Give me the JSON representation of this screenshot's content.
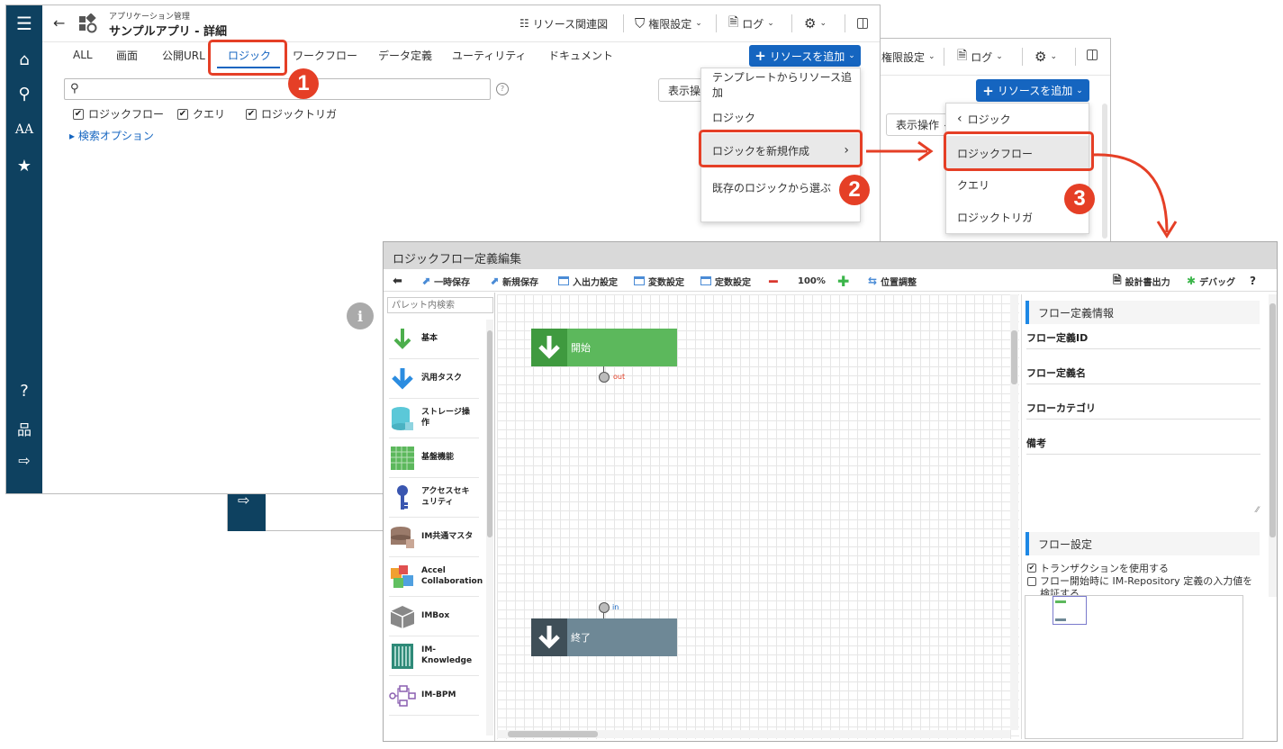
{
  "main_window": {
    "breadcrumb": "アプリケーション管理",
    "title": "サンプルアプリ - 詳細",
    "header_buttons": {
      "resource_map": "リソース関連図",
      "permissions": "権限設定",
      "log": "ログ"
    },
    "tabs": [
      "ALL",
      "画面",
      "公開URL",
      "ロジック",
      "ワークフロー",
      "データ定義",
      "ユーティリティ",
      "ドキュメント"
    ],
    "active_tab": "ロジック",
    "add_resource_label": "リソースを追加",
    "filters": [
      "ロジックフロー",
      "クエリ",
      "ロジックトリガ"
    ],
    "search_options": "▸ 検索オプション",
    "display_ops": "表示操作"
  },
  "dropdown1": {
    "items": [
      "テンプレートからリソース追加",
      "ロジック",
      "ロジックを新規作成",
      "既存のロジックから選ぶ"
    ]
  },
  "back_window": {
    "header_buttons": {
      "permissions": "権限設定",
      "log": "ログ"
    },
    "add_resource_label": "リソースを追加",
    "display_ops": "表示操作"
  },
  "dropdown2": {
    "back_label": "ロジック",
    "items": [
      "ロジックフロー",
      "クエリ",
      "ロジックトリガ"
    ]
  },
  "badges": [
    "1",
    "2",
    "3"
  ],
  "editor": {
    "title": "ロジックフロー定義編集",
    "toolbar": {
      "temp_save": "一時保存",
      "new_save": "新規保存",
      "io_settings": "入出力設定",
      "var_settings": "変数設定",
      "const_settings": "定数設定",
      "zoom": "100%",
      "position": "位置調整",
      "spec_output": "設計書出力",
      "debug": "デバッグ",
      "help": "?"
    },
    "palette_search_placeholder": "パレット内検索",
    "palette": [
      "基本",
      "汎用タスク",
      "ストレージ操作",
      "基盤機能",
      "アクセスセキュリティ",
      "IM共通マスタ",
      "Accel Collaboration",
      "IMBox",
      "IM-Knowledge",
      "IM-BPM"
    ],
    "start_node": "開始",
    "start_port": "out",
    "end_node": "終了",
    "end_port": "in",
    "info_section": "フロー定義情報",
    "fields": [
      "フロー定義ID",
      "フロー定義名",
      "フローカテゴリ",
      "備考"
    ],
    "settings_section": "フロー設定",
    "transaction_label": "トランザクションを使用する",
    "validate_label": "フロー開始時に IM-Repository 定義の入力値を検証する"
  },
  "colors": {
    "accent": "#1565c0",
    "highlight": "#e53f26",
    "sidebar": "#0e4160",
    "start_node": "#5cb85c",
    "end_node": "#6e8896"
  }
}
